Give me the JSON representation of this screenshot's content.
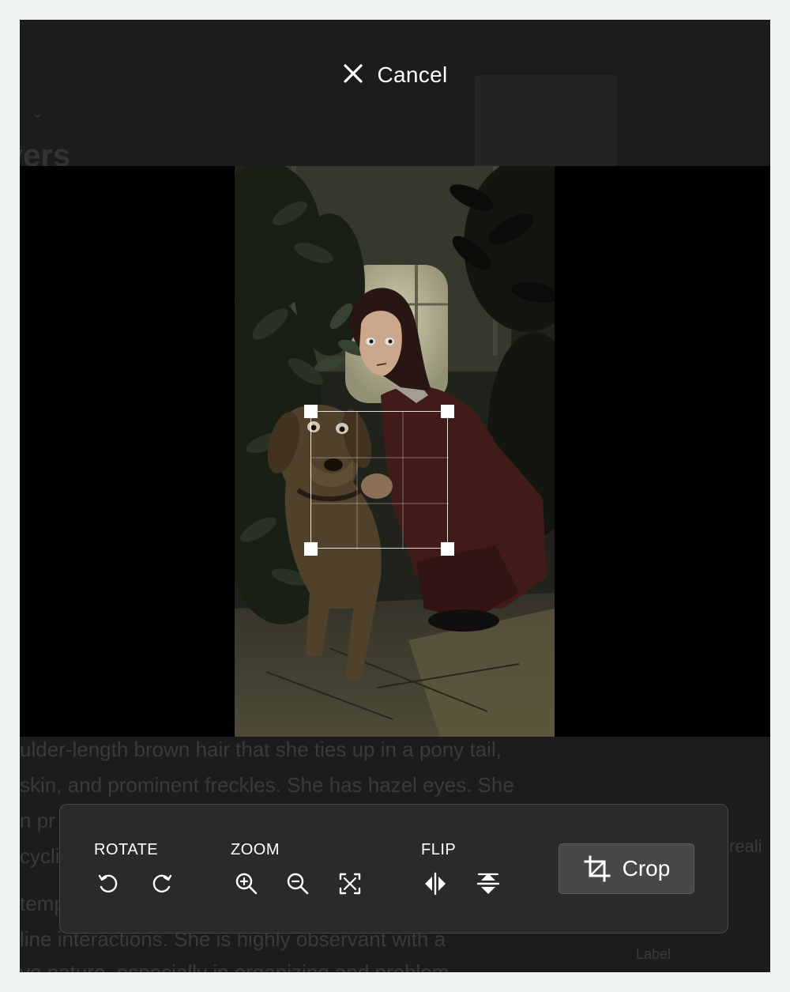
{
  "header": {
    "cancel_label": "Cancel"
  },
  "background_page": {
    "heading_fragment": "yers",
    "text_lines": [
      "ulder-length brown hair that she ties up in a pony tail,",
      "skin, and prominent freckles. She has hazel eyes. She",
      "n pr",
      "cycli",
      "temp",
      "line interactions. She is highly observant with a",
      "ve nature, especially in organizing and problem-"
    ],
    "right_fragments": [
      "reali",
      "Label"
    ]
  },
  "toolbar": {
    "rotate": {
      "label": "ROTATE",
      "left_icon": "rotate-ccw-icon",
      "right_icon": "rotate-cw-icon"
    },
    "zoom": {
      "label": "ZOOM",
      "in_icon": "zoom-in-icon",
      "out_icon": "zoom-out-icon",
      "fit_icon": "fit-screen-icon"
    },
    "flip": {
      "label": "FLIP",
      "horizontal_icon": "flip-horizontal-icon",
      "vertical_icon": "flip-vertical-icon"
    },
    "crop": {
      "label": "Crop",
      "icon": "crop-icon"
    }
  },
  "colors": {
    "modal_bg": "#1c1c1e",
    "stage_bg": "#000000",
    "toolbar_bg": "#2a2a2d",
    "crop_button_bg": "#48484b",
    "handle": "#ffffff"
  }
}
